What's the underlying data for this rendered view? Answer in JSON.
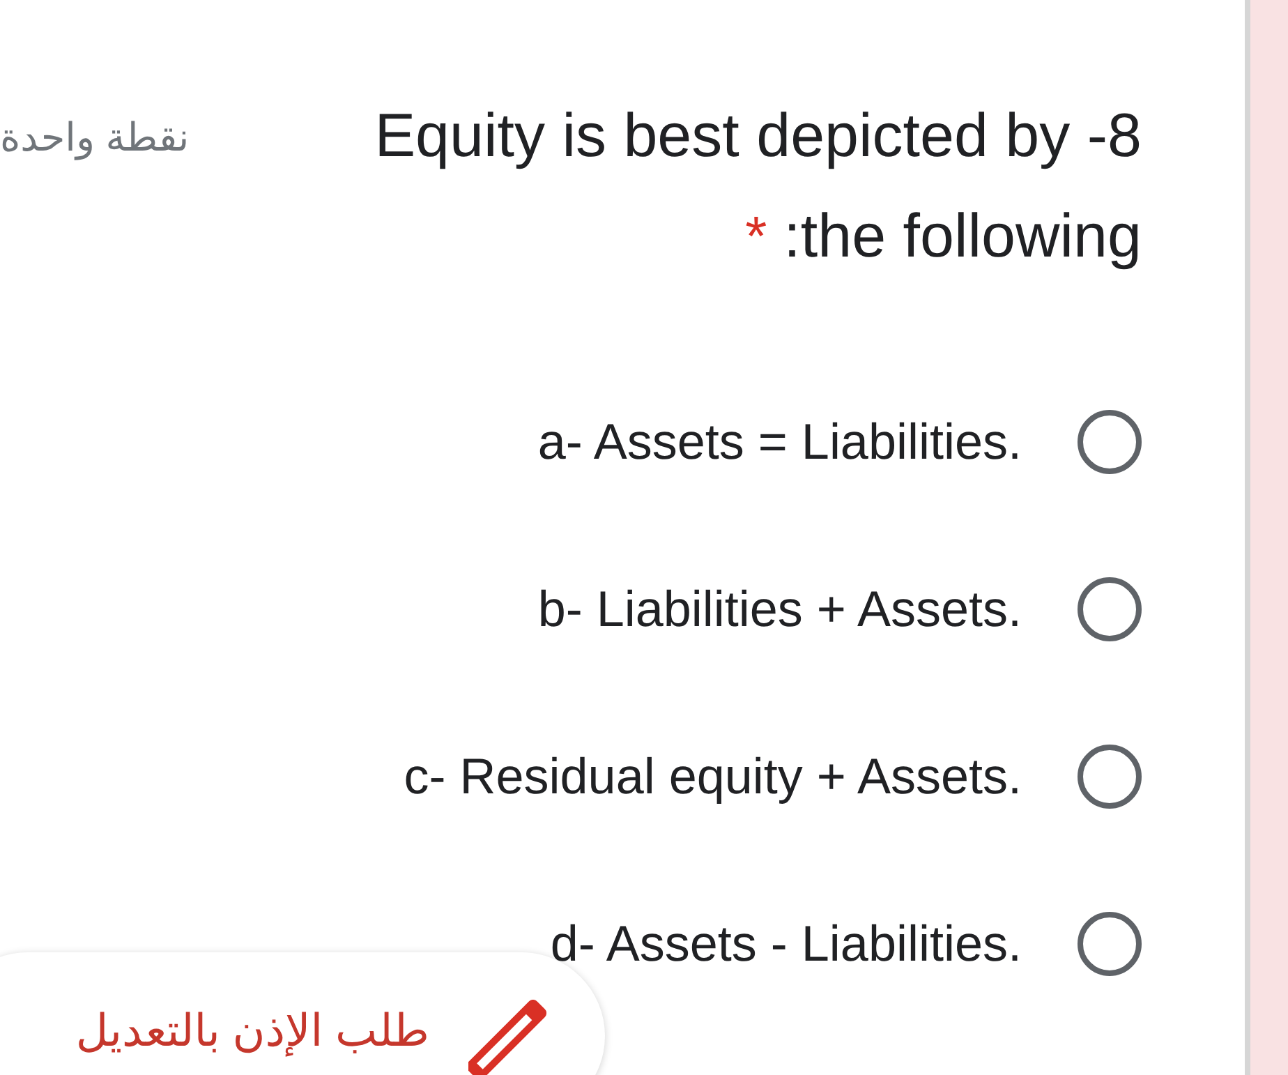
{
  "question": {
    "points": "نقطة واحدة",
    "title_lines": [
      "Equity is best depicted by -8",
      ":the following"
    ],
    "required_mark": "*"
  },
  "options": [
    {
      "label": "a- Assets = Liabilities.",
      "selected": false
    },
    {
      "label": "b- Liabilities + Assets.",
      "selected": false
    },
    {
      "label": "c- Residual equity + Assets.",
      "selected": false
    },
    {
      "label": "d- Assets - Liabilities.",
      "selected": false
    }
  ],
  "edit_button": {
    "label": "طلب الإذن بالتعديل"
  }
}
